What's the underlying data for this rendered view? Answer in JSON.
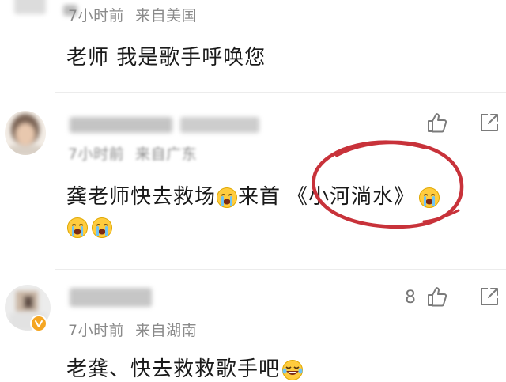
{
  "comments": [
    {
      "meta_time": "7小时前",
      "meta_location": "来自美国",
      "text": "老师 我是歌手呼唤您"
    },
    {
      "meta_time": "7小时前",
      "meta_location": "来自广东",
      "text_a": "龚老师快去救场",
      "text_b": "来首",
      "text_c": "《小河淌水》"
    },
    {
      "like_count": "8",
      "meta_time": "7小时前",
      "meta_location": "来自湖南",
      "text": "老龚、快去救救歌手吧"
    }
  ],
  "colors": {
    "annotation_circle": "#c8323a",
    "meta_gray": "#8a8a8a",
    "badge": "#f5a623"
  },
  "icons": {
    "like": "thumbs-up-icon",
    "share": "share-icon",
    "crying": "loudly-crying-emoji",
    "laughing": "tears-of-joy-emoji"
  }
}
